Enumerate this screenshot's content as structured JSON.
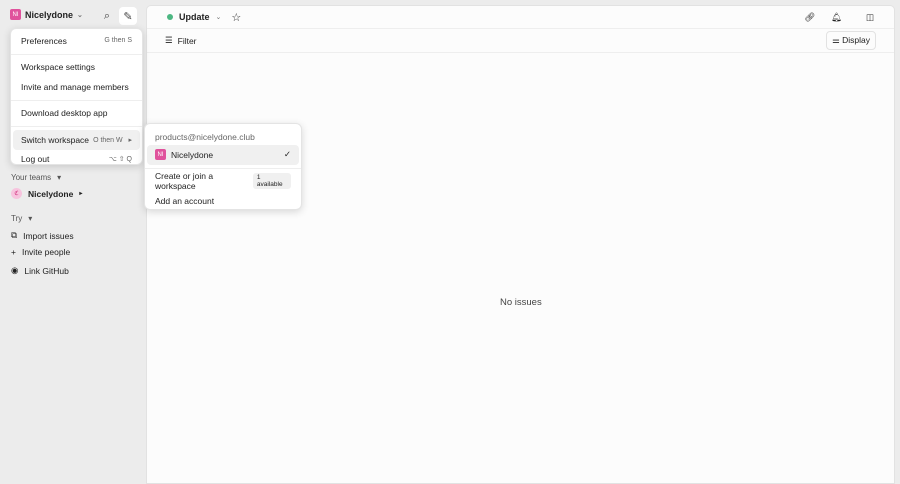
{
  "workspace": {
    "name": "Nicelydone",
    "initials": "NI"
  },
  "menu": [
    {
      "label": "Preferences",
      "shortcut": "G then S"
    },
    {
      "label": "Workspace settings"
    },
    {
      "label": "Invite and manage members"
    },
    {
      "label": "Download desktop app"
    },
    {
      "label": "Switch workspace",
      "shortcut": "O then W"
    },
    {
      "label": "Log out",
      "shortcut": "⌥ ⇧ Q"
    }
  ],
  "submenu": {
    "email": "products@nicelydone.club",
    "workspace": "Nicelydone",
    "initials": "NI",
    "create": "Create or join a workspace",
    "badge": "1 available",
    "add": "Add an account"
  },
  "sidebar": {
    "your_teams": "Your teams",
    "team": "Nicelydone",
    "try": "Try",
    "items": [
      "Import issues",
      "Invite people",
      "Link GitHub"
    ]
  },
  "header": {
    "view": "Update",
    "filter": "Filter",
    "display": "Display"
  },
  "empty": "No issues",
  "colors": {
    "accent": "#e0529c",
    "status": "#4cb782"
  }
}
